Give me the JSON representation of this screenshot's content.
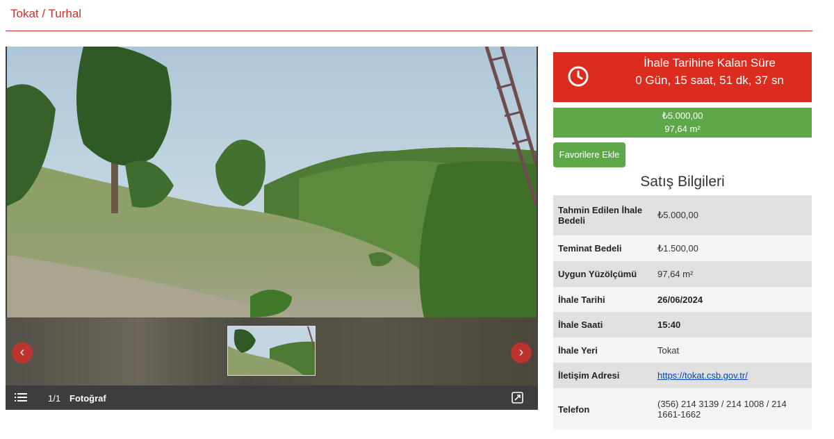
{
  "header": {
    "title": "Tokat / Turhal"
  },
  "gallery": {
    "counter": "1/1",
    "photo_label": "Fotoğraf",
    "prev_icon": "chevron-left-icon",
    "next_icon": "chevron-right-icon",
    "list_icon": "list-icon",
    "fullscreen_icon": "fullscreen-icon"
  },
  "countdown": {
    "title": "İhale Tarihine Kalan Süre",
    "value": "0 Gün, 15 saat, 51 dk, 37 sn",
    "icon": "clock-icon"
  },
  "price_box": {
    "price": "₺5.000,00",
    "area": "97,64 m²"
  },
  "favorite_button": "Favorilere Ekle",
  "sales_info": {
    "title": "Satış Bilgileri",
    "rows": [
      {
        "label": "Tahmin Edilen İhale Bedeli",
        "value": "₺5.000,00"
      },
      {
        "label": "Teminat Bedeli",
        "value": "₺1.500,00"
      },
      {
        "label": "Uygun Yüzölçümü",
        "value": "97,64 m²"
      },
      {
        "label": "İhale Tarihi",
        "value": "26/06/2024"
      },
      {
        "label": "İhale Saati",
        "value": "15:40"
      },
      {
        "label": "İhale Yeri",
        "value": "Tokat"
      },
      {
        "label": "İletişim Adresi",
        "value": "https://tokat.csb.gov.tr/"
      },
      {
        "label": "Telefon",
        "value": "(356) 214 3139 / 214 1008 / 214 1661-1662"
      }
    ]
  },
  "colors": {
    "brand_red": "#c9302c",
    "countdown_red": "#dc2b1f",
    "green": "#5fa84a"
  }
}
